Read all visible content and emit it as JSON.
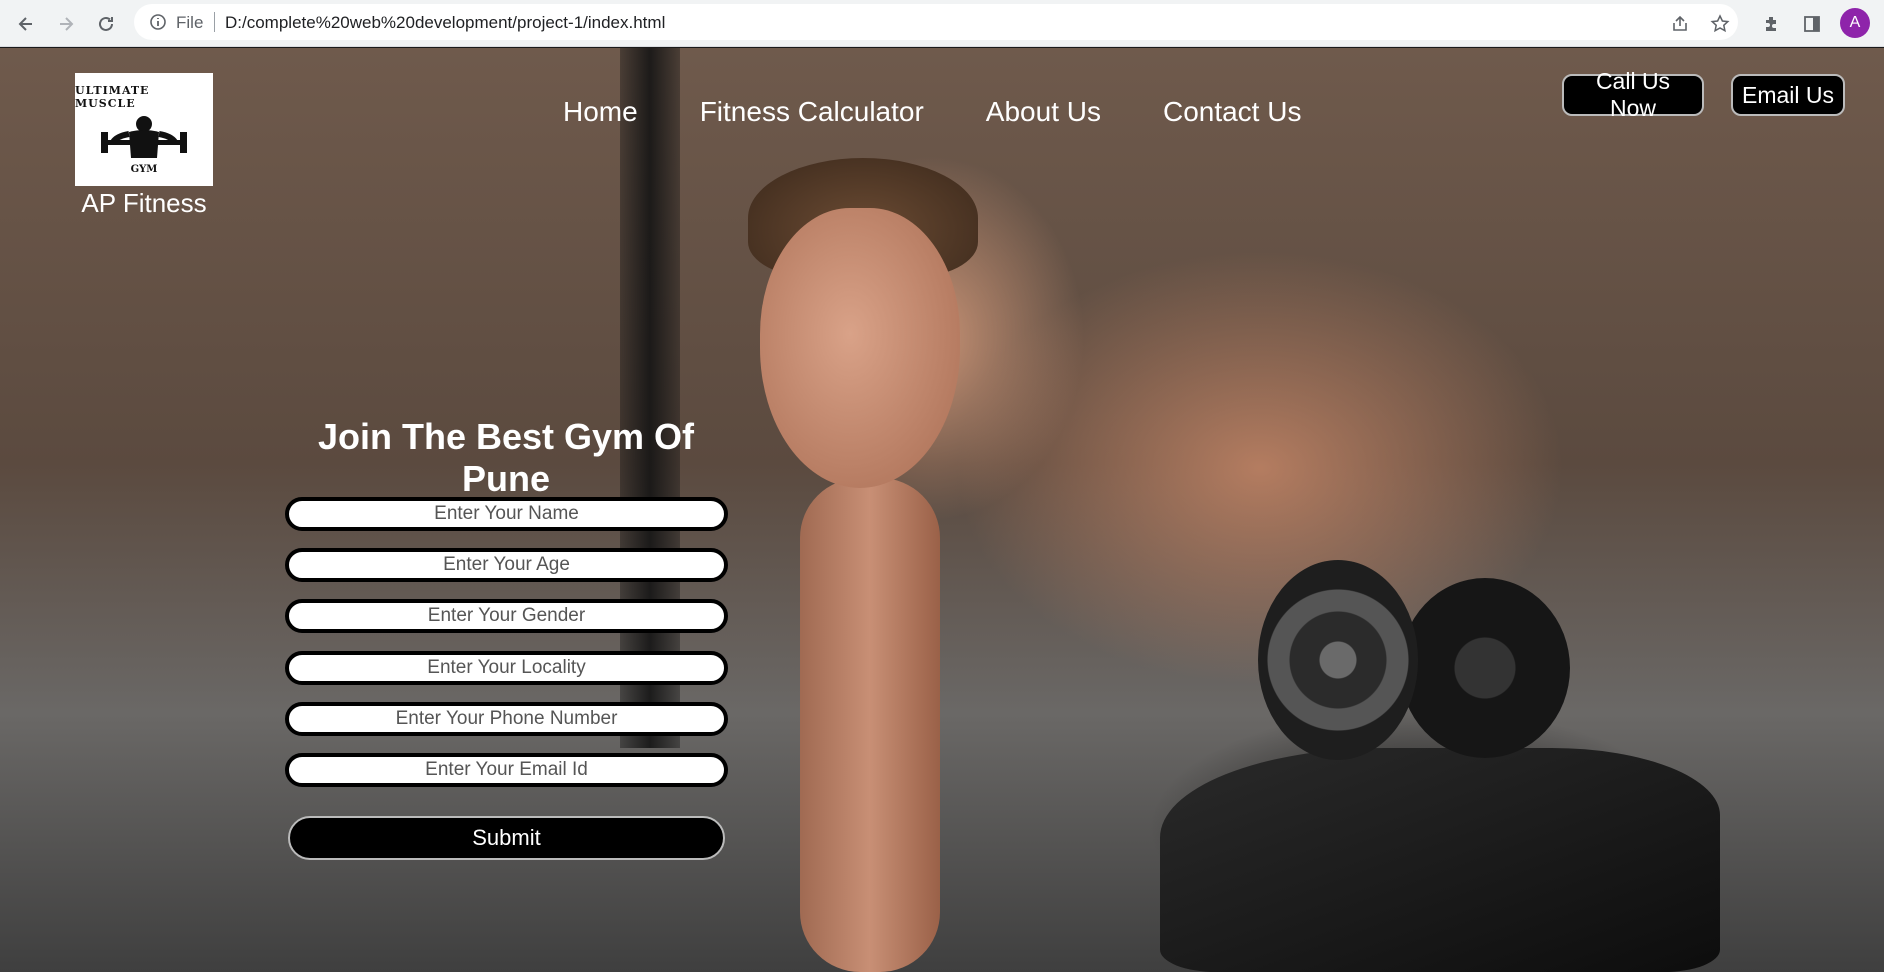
{
  "browser": {
    "file_label": "File",
    "url": "D:/complete%20web%20development/project-1/index.html",
    "avatar_letter": "A"
  },
  "brand": {
    "logo_text_top": "ULTIMATE MUSCLE",
    "logo_text_bottom": "GYM",
    "name": "AP Fitness"
  },
  "nav": {
    "items": [
      "Home",
      "Fitness Calculator",
      "About Us",
      "Contact Us"
    ]
  },
  "actions": {
    "call": "Call Us Now",
    "email": "Email Us"
  },
  "form": {
    "title": "Join The Best Gym Of Pune",
    "fields": [
      "Enter Your Name",
      "Enter Your Age",
      "Enter Your Gender",
      "Enter Your Locality",
      "Enter Your Phone Number",
      "Enter Your Email Id"
    ],
    "submit": "Submit"
  }
}
